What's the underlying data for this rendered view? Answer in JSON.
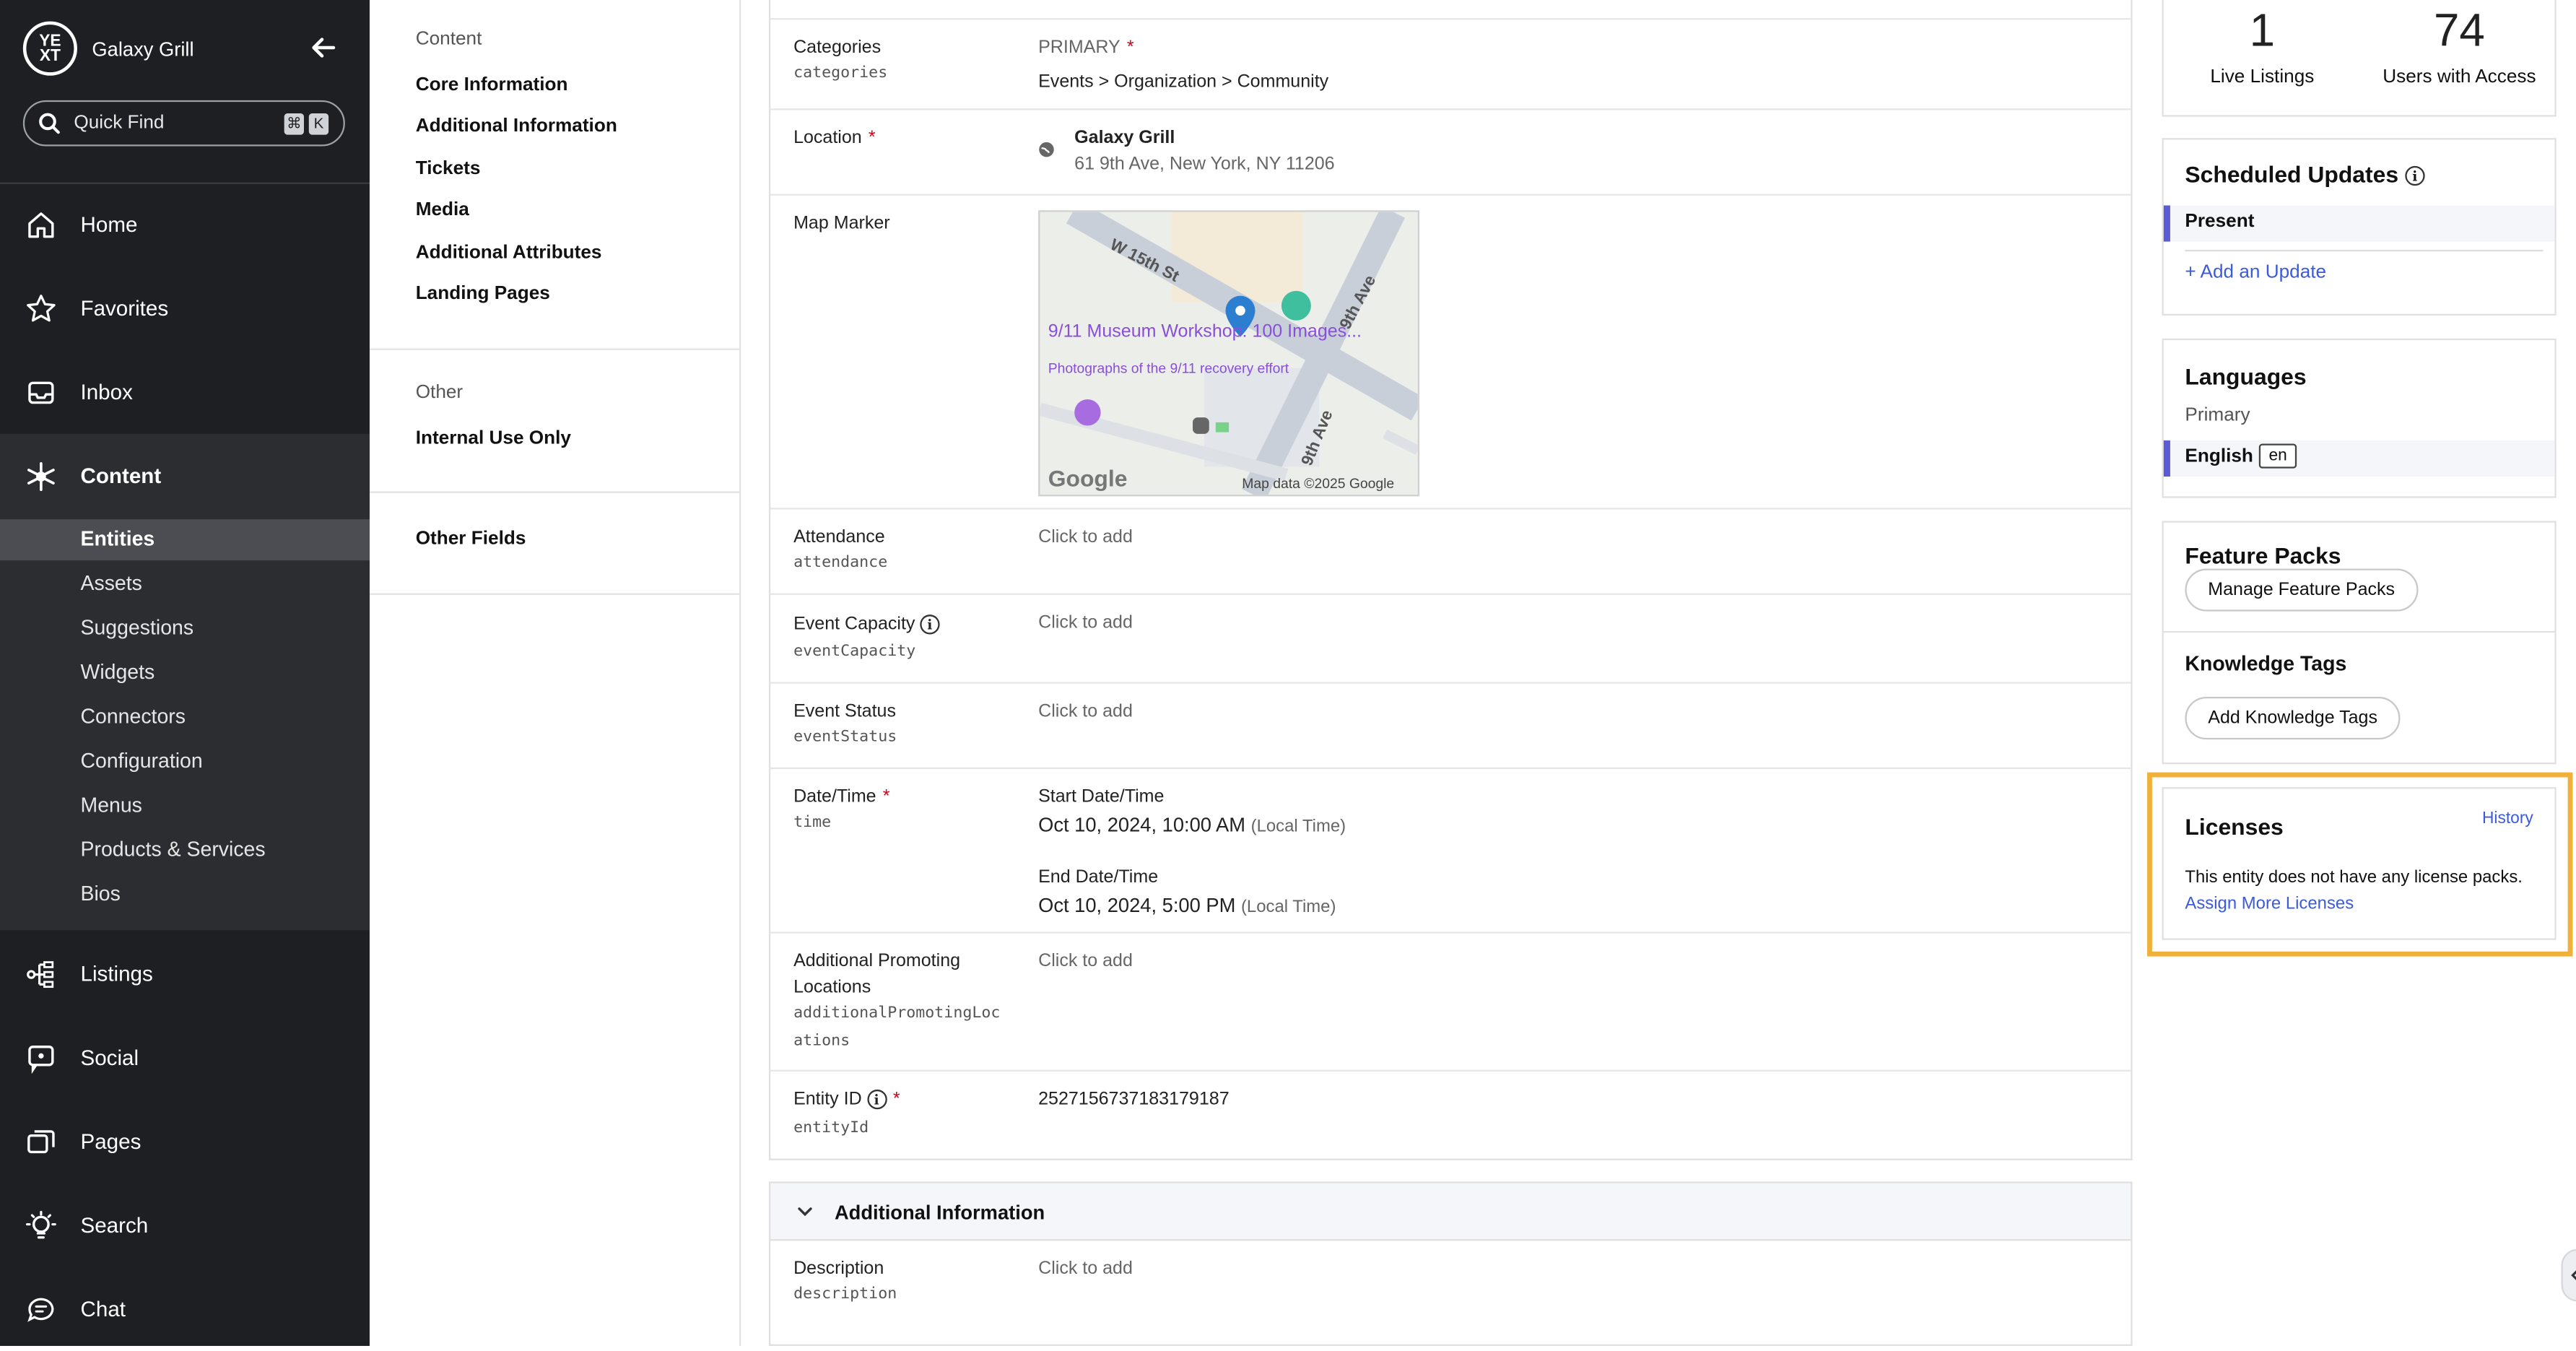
{
  "sidebar": {
    "brand": "Galaxy Grill",
    "logo_text": "YE XT",
    "quick_find": {
      "label": "Quick Find",
      "keys": [
        "⌘",
        "K"
      ]
    },
    "nav": [
      {
        "label": "Home",
        "icon": "home-icon"
      },
      {
        "label": "Favorites",
        "icon": "star-icon"
      },
      {
        "label": "Inbox",
        "icon": "inbox-icon"
      },
      {
        "label": "Content",
        "icon": "content-icon",
        "active": true
      },
      {
        "label": "Listings",
        "icon": "listings-icon"
      },
      {
        "label": "Social",
        "icon": "social-icon"
      },
      {
        "label": "Pages",
        "icon": "pages-icon"
      },
      {
        "label": "Search",
        "icon": "lightbulb-icon"
      },
      {
        "label": "Chat",
        "icon": "chat-icon"
      }
    ],
    "content_sub": [
      {
        "label": "Entities",
        "active": true
      },
      {
        "label": "Assets"
      },
      {
        "label": "Suggestions"
      },
      {
        "label": "Widgets"
      },
      {
        "label": "Connectors"
      },
      {
        "label": "Configuration"
      },
      {
        "label": "Menus"
      },
      {
        "label": "Products & Services"
      },
      {
        "label": "Bios"
      }
    ]
  },
  "section_nav": {
    "content_title": "Content",
    "content_links": [
      "Core Information",
      "Additional Information",
      "Tickets",
      "Media",
      "Additional Attributes",
      "Landing Pages"
    ],
    "other_title": "Other",
    "other_links": [
      "Internal Use Only"
    ],
    "other_fields": "Other Fields"
  },
  "form": {
    "categories": {
      "label": "Categories",
      "key": "categories",
      "primary": "PRIMARY",
      "value": "Events > Organization > Community"
    },
    "location": {
      "label": "Location",
      "name": "Galaxy Grill",
      "address": "61 9th Ave, New York, NY 11206"
    },
    "map_marker": {
      "label": "Map Marker",
      "streets": [
        "W 15th St",
        "9th Ave",
        "9th Ave"
      ],
      "poi_title": "9/11 Museum Workshop: 100 Images...",
      "poi_sub": "Photographs of the 9/11 recovery effort",
      "google": "Google",
      "attribution": "Map data ©2025 Google"
    },
    "attendance": {
      "label": "Attendance",
      "key": "attendance",
      "value": "Click to add"
    },
    "event_capacity": {
      "label": "Event Capacity",
      "key": "eventCapacity",
      "value": "Click to add"
    },
    "event_status": {
      "label": "Event Status",
      "key": "eventStatus",
      "value": "Click to add"
    },
    "date_time": {
      "label": "Date/Time",
      "key": "time",
      "start_label": "Start Date/Time",
      "start_value": "Oct 10, 2024, 10:00 AM",
      "start_note": "(Local Time)",
      "end_label": "End Date/Time",
      "end_value": "Oct 10, 2024, 5:00 PM",
      "end_note": "(Local Time)"
    },
    "additional_promoting": {
      "label_line1": "Additional Promoting",
      "label_line2": "Locations",
      "key_line1": "additionalPromotingLoc",
      "key_line2": "ations",
      "value": "Click to add"
    },
    "entity_id": {
      "label": "Entity ID",
      "key": "entityId",
      "value": "2527156737183179187"
    },
    "additional_info_header": "Additional Information",
    "description": {
      "label": "Description",
      "key": "description",
      "value": "Click to add"
    },
    "required_mark": "*",
    "info_glyph": "i"
  },
  "right": {
    "stats": [
      {
        "value": "1",
        "label": "Live Listings"
      },
      {
        "value": "74",
        "label": "Users with Access"
      }
    ],
    "scheduled": {
      "title": "Scheduled Updates",
      "present": "Present",
      "add": "+ Add an Update"
    },
    "languages": {
      "title": "Languages",
      "primary": "Primary",
      "lang": "English",
      "code": "en"
    },
    "feature_packs": {
      "title": "Feature Packs",
      "button": "Manage Feature Packs"
    },
    "knowledge_tags": {
      "title": "Knowledge Tags",
      "button": "Add Knowledge Tags"
    },
    "licenses": {
      "title": "Licenses",
      "history": "History",
      "message": "This entity does not have any license packs.",
      "assign": "Assign More Licenses"
    }
  },
  "colors": {
    "sidebar_bg": "#1e1f22",
    "accent": "#5b5bd6",
    "link": "#3b5bdb",
    "highlight": "#f0b13a",
    "required": "#d0021b"
  }
}
